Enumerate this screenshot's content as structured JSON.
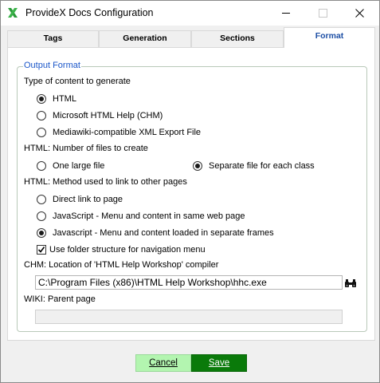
{
  "window": {
    "title": "ProvideX Docs Configuration",
    "icon": "providex-x-icon",
    "controls": [
      "minimize-icon",
      "maximize-icon",
      "close-icon"
    ]
  },
  "tabs": [
    {
      "label": "Tags",
      "active": false
    },
    {
      "label": "Generation",
      "active": false
    },
    {
      "label": "Sections",
      "active": false
    },
    {
      "label": "Format",
      "active": true
    }
  ],
  "output_format": {
    "legend": "Output Format",
    "content_type": {
      "label": "Type of content to generate",
      "options": [
        {
          "label": "HTML",
          "selected": true
        },
        {
          "label": "Microsoft HTML Help (CHM)",
          "selected": false
        },
        {
          "label": "Mediawiki-compatible XML Export File",
          "selected": false
        }
      ]
    },
    "num_files": {
      "label": "HTML: Number of files to create",
      "options": [
        {
          "label": "One large file",
          "selected": false
        },
        {
          "label": "Separate file for each class",
          "selected": true
        }
      ]
    },
    "link_method": {
      "label": "HTML: Method used to link to other pages",
      "options": [
        {
          "label": "Direct link to page",
          "selected": false
        },
        {
          "label": "JavaScript - Menu and content in same web page",
          "selected": false
        },
        {
          "label": "Javascript - Menu and content loaded in separate frames",
          "selected": true
        }
      ]
    },
    "folder_structure": {
      "label": "Use folder structure for navigation menu",
      "checked": true
    },
    "chm": {
      "label": "CHM: Location of 'HTML Help Workshop' compiler",
      "value": "C:\\Program Files (x86)\\HTML Help Workshop\\hhc.exe"
    },
    "wiki": {
      "label": "WIKI: Parent page",
      "value": ""
    }
  },
  "buttons": {
    "cancel_label": "Cancel",
    "save_label": "Save"
  },
  "colors": {
    "accent": "#1a56c9",
    "cancel_bg": "#b3f5b0",
    "save_bg": "#0a7a0a"
  }
}
